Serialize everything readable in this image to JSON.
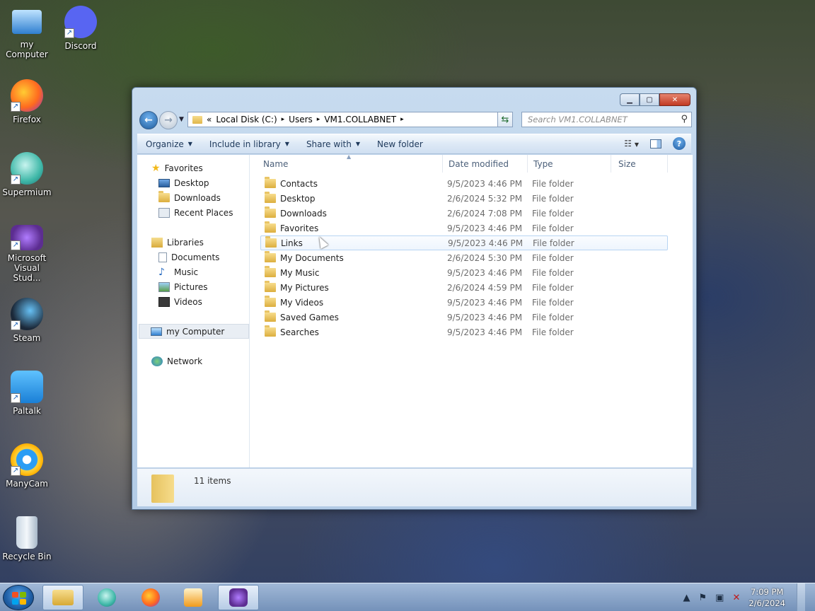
{
  "desktop": {
    "icons": [
      {
        "label": "my Computer",
        "icon": "computer-icon"
      },
      {
        "label": "Discord",
        "icon": "discord-icon"
      },
      {
        "label": "Firefox",
        "icon": "firefox-icon"
      },
      {
        "label": "Supermium",
        "icon": "supermium-icon"
      },
      {
        "label": "Microsoft Visual Stud...",
        "icon": "visual-studio-icon"
      },
      {
        "label": "Steam",
        "icon": "steam-icon"
      },
      {
        "label": "Paltalk",
        "icon": "paltalk-icon"
      },
      {
        "label": "ManyCam",
        "icon": "manycam-icon"
      },
      {
        "label": "Recycle Bin",
        "icon": "recycle-bin-icon"
      }
    ]
  },
  "window": {
    "address": {
      "chevron": "«",
      "parts": [
        "Local Disk (C:)",
        "Users",
        "VM1.COLLABNET"
      ],
      "sep": "▸"
    },
    "search_placeholder": "Search VM1.COLLABNET",
    "toolbar": {
      "organize": "Organize",
      "include": "Include in library",
      "share": "Share with",
      "new_folder": "New folder"
    },
    "nav": {
      "favorites": "Favorites",
      "fav_items": [
        "Desktop",
        "Downloads",
        "Recent Places"
      ],
      "libraries": "Libraries",
      "lib_items": [
        "Documents",
        "Music",
        "Pictures",
        "Videos"
      ],
      "computer": "my Computer",
      "network": "Network"
    },
    "columns": {
      "name": "Name",
      "date": "Date modified",
      "type": "Type",
      "size": "Size"
    },
    "files": [
      {
        "name": "Contacts",
        "date": "9/5/2023 4:46 PM",
        "type": "File folder"
      },
      {
        "name": "Desktop",
        "date": "2/6/2024 5:32 PM",
        "type": "File folder"
      },
      {
        "name": "Downloads",
        "date": "2/6/2024 7:08 PM",
        "type": "File folder"
      },
      {
        "name": "Favorites",
        "date": "9/5/2023 4:46 PM",
        "type": "File folder"
      },
      {
        "name": "Links",
        "date": "9/5/2023 4:46 PM",
        "type": "File folder"
      },
      {
        "name": "My Documents",
        "date": "2/6/2024 5:30 PM",
        "type": "File folder"
      },
      {
        "name": "My Music",
        "date": "9/5/2023 4:46 PM",
        "type": "File folder"
      },
      {
        "name": "My Pictures",
        "date": "2/6/2024 4:59 PM",
        "type": "File folder"
      },
      {
        "name": "My Videos",
        "date": "9/5/2023 4:46 PM",
        "type": "File folder"
      },
      {
        "name": "Saved Games",
        "date": "9/5/2023 4:46 PM",
        "type": "File folder"
      },
      {
        "name": "Searches",
        "date": "9/5/2023 4:46 PM",
        "type": "File folder"
      }
    ],
    "status": "11 items"
  },
  "taskbar": {
    "time": "7:09 PM",
    "date": "2/6/2024"
  }
}
